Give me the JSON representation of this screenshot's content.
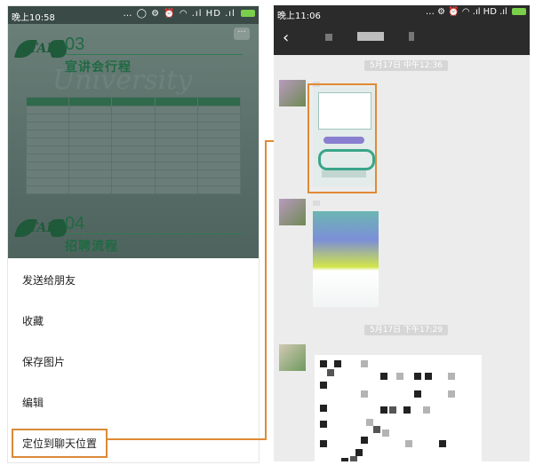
{
  "left_screen": {
    "status_bar": {
      "time": "晚上10:58",
      "icons": "… ◯ ⚙ ⏰ ◠ .ıl HD .ıl",
      "net_label": "HD"
    },
    "poster": {
      "logo_text": "TAL",
      "section3_number": "03",
      "section3_title": "宣讲会行程",
      "section4_number": "04",
      "section4_title": "招聘流程",
      "watermark": "University"
    },
    "menu": {
      "send_to_friend": "发送给朋友",
      "favorite": "收藏",
      "save_image": "保存图片",
      "edit": "编辑",
      "locate_in_chat": "定位到聊天位置"
    }
  },
  "right_screen": {
    "status_bar": {
      "time": "晚上11:06",
      "icons": "… ⚙ ⏰ ◠ .ıl HD .ıl"
    },
    "timestamps": [
      "5月17日 中午12:36",
      "5月17日 下午17:29"
    ]
  },
  "colors": {
    "accent": "#e08a35",
    "poster_green": "#1f6a42",
    "chat_bg": "#ececec",
    "titlebar": "#2b2b2b"
  }
}
